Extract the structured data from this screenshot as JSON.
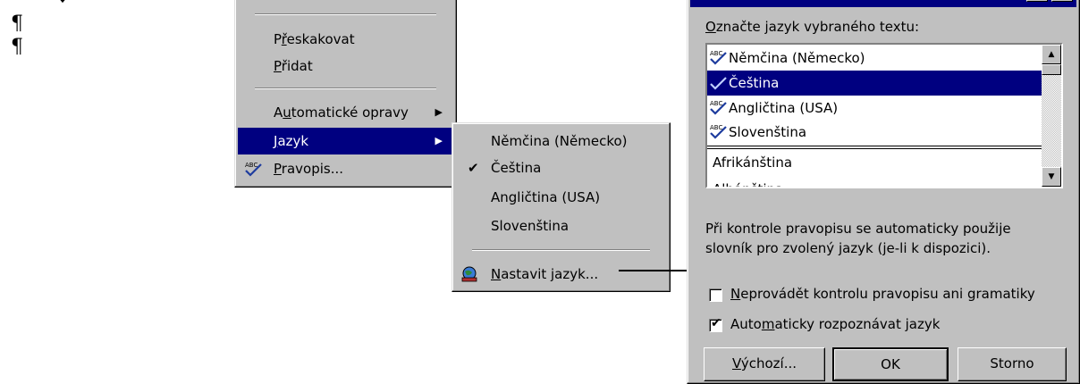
{
  "document": {
    "pilcrows": [
      "¶",
      "¶"
    ]
  },
  "context_menu": {
    "items": [
      {
        "label": "Přeskakovat",
        "accel_index": 2
      },
      {
        "label": "Přidat",
        "accel_index": 0
      },
      {
        "label": "Automatické opravy",
        "accel_index": 1,
        "submenu": true
      },
      {
        "label": "Jazyk",
        "accel_index": 0,
        "submenu": true,
        "selected": true
      },
      {
        "label": "Pravopis...",
        "accel_index": 0,
        "icon": "spelling-abc-check-icon"
      }
    ]
  },
  "language_submenu": {
    "items": [
      {
        "label": "Němčina (Německo)"
      },
      {
        "label": "Čeština",
        "checked": true
      },
      {
        "label": "Angličtina (USA)"
      },
      {
        "label": "Slovenština"
      },
      {
        "label": "Nastavit jazyk...",
        "accel_index": 0,
        "icon": "language-globe-icon"
      }
    ]
  },
  "dialog": {
    "prompt_label": "Označte jazyk vybraného textu:",
    "languages_recent": [
      {
        "label": "Němčina (Německo)",
        "icon": "spelling-abc-check-icon"
      },
      {
        "label": "Čeština",
        "icon": "check-icon",
        "selected": true
      },
      {
        "label": "Angličtina (USA)",
        "icon": "spelling-abc-check-icon"
      },
      {
        "label": "Slovenština",
        "icon": "spelling-abc-check-icon"
      }
    ],
    "languages_all": [
      "Afrikánština",
      "Albánština"
    ],
    "info_line1": "Při kontrole pravopisu se automaticky použije",
    "info_line2": "slovník pro zvolený jazyk (je-li k dispozici).",
    "checkbox_no_proofing": {
      "label": "Neprovádět kontrolu pravopisu ani gramatiky",
      "checked": false
    },
    "checkbox_autodetect": {
      "label": "Automaticky rozpoznávat jazyk",
      "checked": true
    },
    "buttons": {
      "default": "Výchozí...",
      "ok": "OK",
      "cancel": "Storno"
    }
  },
  "colors": {
    "face": "#c0c0c0",
    "highlight": "#000080",
    "abc_blue": "#1e3c9e"
  }
}
